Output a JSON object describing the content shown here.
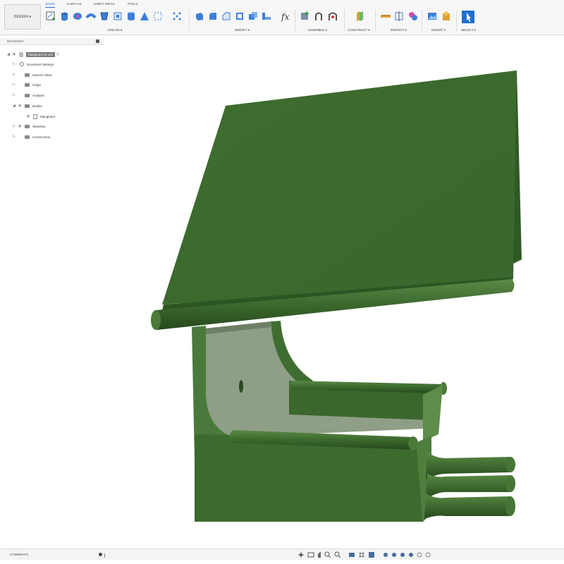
{
  "toolbar": {
    "workspace": "DESIGN ▾",
    "tabs": [
      "SOLID",
      "SURFACE",
      "SHEET METAL",
      "TOOLS"
    ],
    "groups": {
      "create": "CREATE ▾",
      "modify": "MODIFY ▾",
      "assemble": "ASSEMBLE ▾",
      "construct": "CONSTRUCT ▾",
      "inspect": "INSPECT ▾",
      "insert": "INSERT ▾",
      "select": "SELECT ▾"
    },
    "accent": "#1f6fd0"
  },
  "browser": {
    "title": "BROWSER",
    "root": "Mangeoire M v12",
    "items": [
      {
        "label": "Document Settings",
        "icon": "gear-icon"
      },
      {
        "label": "Named Views",
        "icon": "folder-icon"
      },
      {
        "label": "Origin",
        "icon": "folder-icon"
      },
      {
        "label": "Analysis",
        "icon": "folder-icon"
      },
      {
        "label": "Bodies",
        "icon": "folder-icon"
      },
      {
        "label": "Mangeoire",
        "icon": "body-icon"
      },
      {
        "label": "Sketches",
        "icon": "folder-icon"
      },
      {
        "label": "Construction",
        "icon": "folder-icon"
      }
    ]
  },
  "comments": {
    "label": "COMMENTS"
  },
  "model": {
    "body_color": "#3d6b2e",
    "inner_color": "#8f9e86"
  }
}
